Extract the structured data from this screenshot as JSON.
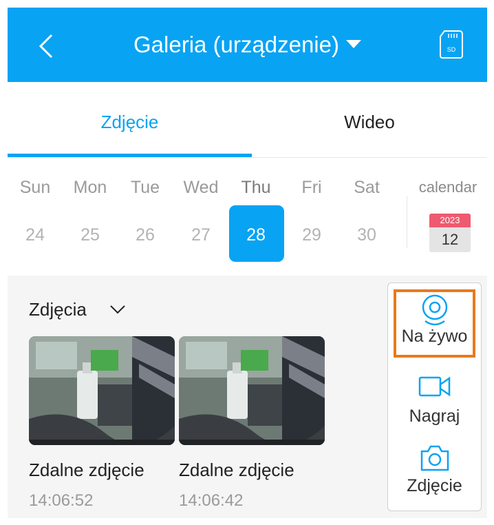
{
  "header": {
    "title": "Galeria (urządzenie)",
    "back_icon": "chevron-left-icon",
    "sd_icon": "sd-card-icon",
    "sd_label": "SD"
  },
  "tabs": [
    {
      "label": "Zdjęcie",
      "active": true
    },
    {
      "label": "Wideo",
      "active": false
    }
  ],
  "week": {
    "days": [
      {
        "name": "Sun",
        "num": "24",
        "selected": false
      },
      {
        "name": "Mon",
        "num": "25",
        "selected": false
      },
      {
        "name": "Tue",
        "num": "26",
        "selected": false
      },
      {
        "name": "Wed",
        "num": "27",
        "selected": false
      },
      {
        "name": "Thu",
        "num": "28",
        "selected": true
      },
      {
        "name": "Fri",
        "num": "29",
        "selected": false
      },
      {
        "name": "Sat",
        "num": "30",
        "selected": false
      }
    ],
    "calendar_label": "calendar",
    "calendar_year": "2023",
    "calendar_day": "12"
  },
  "gallery": {
    "section_title": "Zdjęcia",
    "items": [
      {
        "title": "Zdalne zdjęcie",
        "time": "14:06:52"
      },
      {
        "title": "Zdalne zdjęcie",
        "time": "14:06:42"
      }
    ]
  },
  "side_panel": {
    "live_label": "Na żywo",
    "record_label": "Nagraj",
    "photo_label": "Zdjęcie"
  },
  "colors": {
    "accent": "#09a3f3",
    "highlight_border": "#e87a1a",
    "calendar_year_bg": "#ee5a6f"
  }
}
